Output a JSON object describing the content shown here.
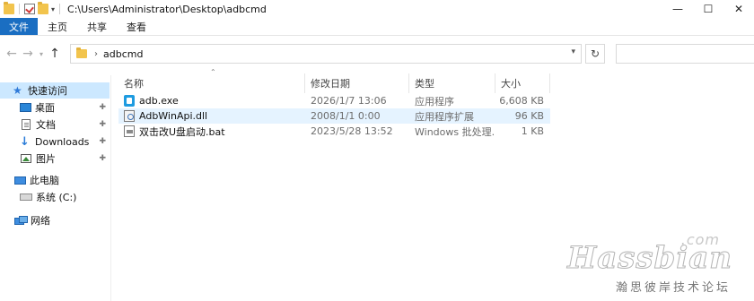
{
  "window": {
    "title": "C:\\Users\\Administrator\\Desktop\\adbcmd",
    "minimize_glyph": "—",
    "maximize_glyph": "☐",
    "close_glyph": "✕"
  },
  "ribbon": {
    "tabs": [
      {
        "label": "文件",
        "active": true
      },
      {
        "label": "主页"
      },
      {
        "label": "共享"
      },
      {
        "label": "查看"
      }
    ]
  },
  "address": {
    "breadcrumb": [
      "adbcmd"
    ],
    "back_icon": "arrow-left-icon",
    "forward_icon": "arrow-right-icon",
    "up_icon": "arrow-up-icon",
    "refresh_icon": "refresh-icon",
    "search_placeholder": ""
  },
  "sidebar": {
    "items": [
      {
        "label": "快速访问",
        "icon": "star-icon",
        "active": true
      },
      {
        "label": "桌面",
        "icon": "desktop-icon",
        "pinned": true
      },
      {
        "label": "文档",
        "icon": "document-icon",
        "pinned": true
      },
      {
        "label": "Downloads",
        "icon": "download-icon",
        "pinned": true
      },
      {
        "label": "图片",
        "icon": "picture-icon",
        "pinned": true
      },
      {
        "label": "此电脑",
        "icon": "computer-icon"
      },
      {
        "label": "系统 (C:)",
        "icon": "drive-icon"
      },
      {
        "label": "网络",
        "icon": "network-icon"
      }
    ]
  },
  "file_list": {
    "columns": [
      "名称",
      "修改日期",
      "类型",
      "大小"
    ],
    "rows": [
      {
        "name": "adb.exe",
        "date": "2026/1/7 13:06",
        "type": "应用程序",
        "size": "6,608 KB",
        "icon": "exe-icon"
      },
      {
        "name": "AdbWinApi.dll",
        "date": "2008/1/1 0:00",
        "type": "应用程序扩展",
        "size": "96 KB",
        "icon": "dll-icon",
        "selected": true
      },
      {
        "name": "双击改U盘启动.bat",
        "date": "2023/5/28 13:52",
        "type": "Windows 批处理...",
        "size": "1 KB",
        "icon": "bat-icon"
      }
    ]
  },
  "watermark": {
    "com": ".com",
    "brand": "Hassbian",
    "subtitle": "瀚思彼岸技术论坛"
  },
  "colors": {
    "accent": "#1a6ec2",
    "selection": "#cce8ff",
    "row_hover": "#e5f3ff"
  }
}
